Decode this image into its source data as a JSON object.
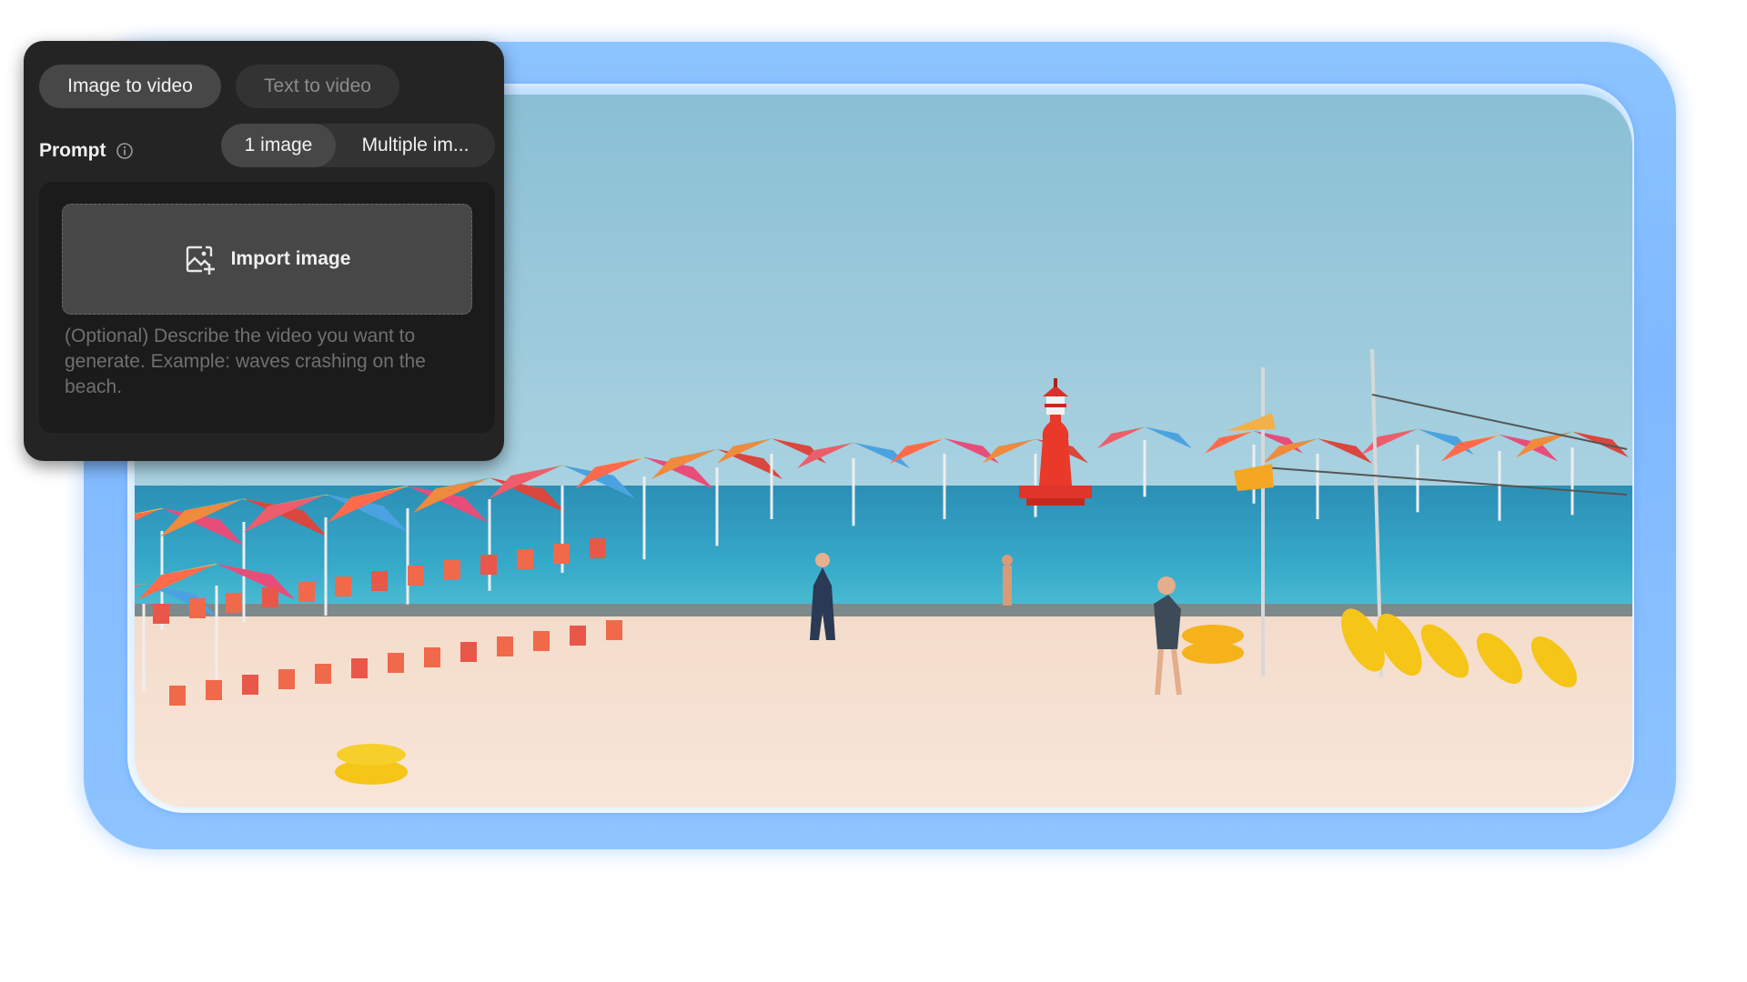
{
  "mode_tabs": [
    {
      "label": "Image to video",
      "active": true
    },
    {
      "label": "Text to video",
      "active": false
    }
  ],
  "prompt": {
    "label": "Prompt",
    "info_icon": "info-circle-icon",
    "image_count_options": [
      {
        "label": "1 image",
        "active": true
      },
      {
        "label": "Multiple im...",
        "active": false
      }
    ],
    "import_button_label": "Import image",
    "import_icon": "image-add-icon",
    "value": "",
    "placeholder": "(Optional) Describe the video you want to generate. Example: waves crashing on the beach."
  },
  "preview": {
    "scene": "beach-with-umbrellas-and-lighthouse"
  },
  "colors": {
    "panel_bg": "#242424",
    "pill_active": "#474747",
    "pill_inactive": "#333333",
    "frame_blue": "#8cc4ff",
    "sky": "#8dbfd6",
    "sea": "#2f9cbf",
    "sand": "#f3dcc8",
    "lighthouse": "#e8392b"
  }
}
